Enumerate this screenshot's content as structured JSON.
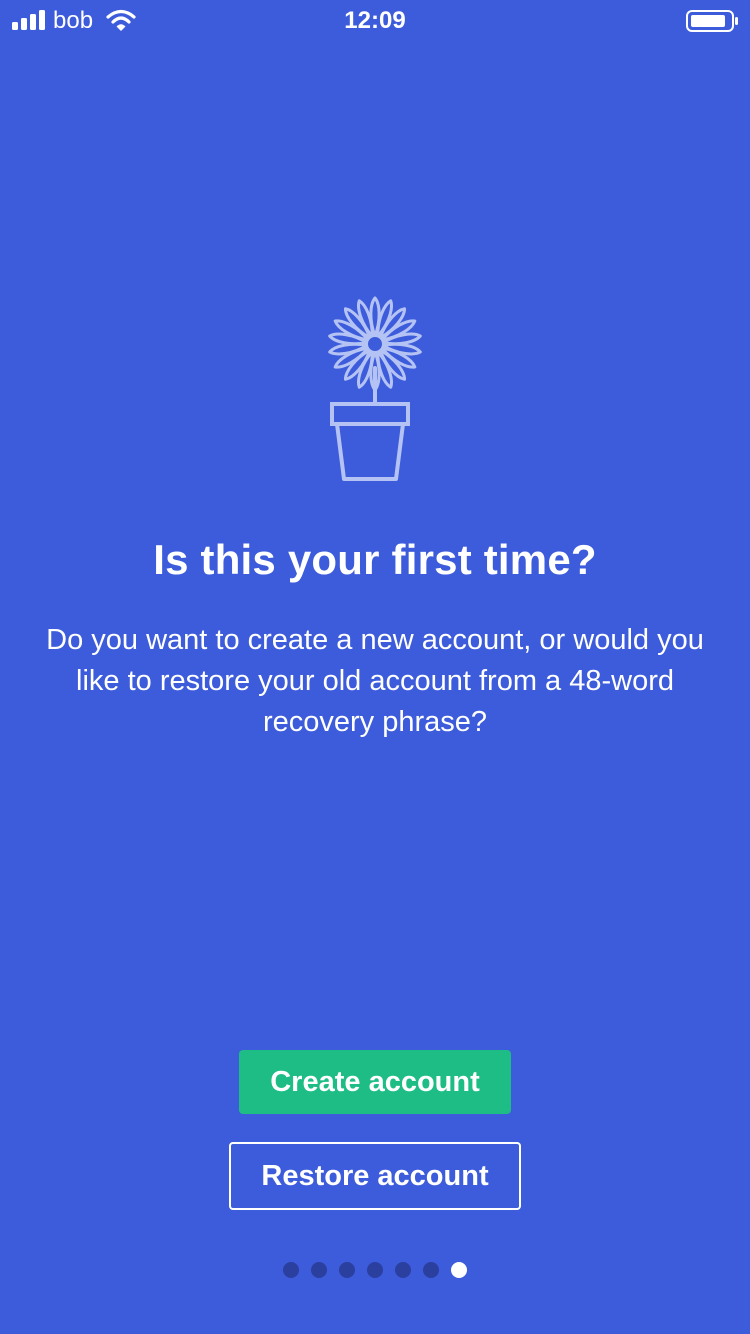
{
  "status_bar": {
    "carrier": "bob",
    "time": "12:09",
    "signal_icon": "signal-bars-icon",
    "wifi_icon": "wifi-icon",
    "battery_icon": "battery-icon"
  },
  "onboarding": {
    "illustration_icon": "flower-pot-icon",
    "title": "Is this your first time?",
    "description": "Do you want to create a new account, or would you like to restore your old account from a 48-word recovery phrase?",
    "create_label": "Create account",
    "restore_label": "Restore account"
  },
  "pager": {
    "total_pages": 7,
    "current_page": 7
  },
  "colors": {
    "background": "#3d5cdb",
    "primary_button": "#1dbd85",
    "inactive_dot": "#2b3f9f",
    "active_dot": "#ffffff"
  }
}
